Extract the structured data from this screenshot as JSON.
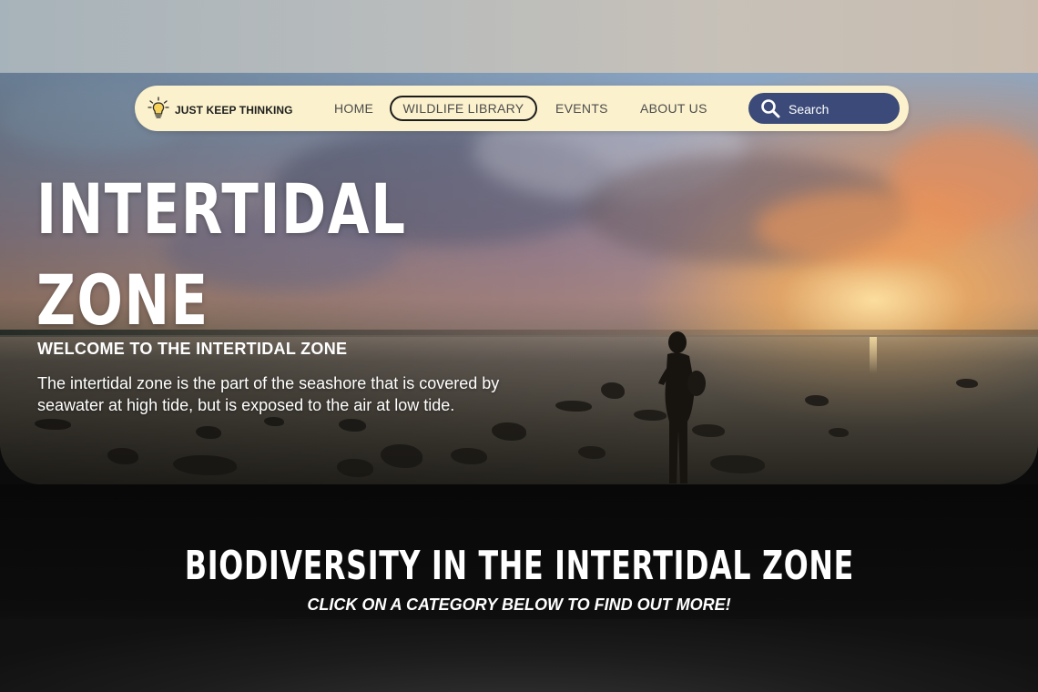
{
  "brand": {
    "name": "JUST KEEP THINKING",
    "icon": "lightbulb-icon"
  },
  "nav": {
    "home": "HOME",
    "wildlife_library": "WILDLIFE LIBRARY",
    "events": "EVENTS",
    "about_us": "ABOUT US",
    "search_placeholder": "Search",
    "search_icon": "search-icon"
  },
  "hero": {
    "title_line1": "INTERTIDAL",
    "title_line2": "ZONE",
    "subtitle": "WELCOME TO THE INTERTIDAL ZONE",
    "description": "The intertidal zone is the part of the seashore that is covered by seawater at high tide, but is exposed to the air at low tide."
  },
  "biodiversity": {
    "title": "BIODIVERSITY IN THE INTERTIDAL ZONE",
    "subtitle": "CLICK ON A CATEGORY BELOW TO FIND OUT MORE!"
  },
  "colors": {
    "nav_background": "#fbf1cc",
    "search_background": "#3b4a78",
    "page_background": "#0b0b0b",
    "text_light": "#ffffff"
  }
}
